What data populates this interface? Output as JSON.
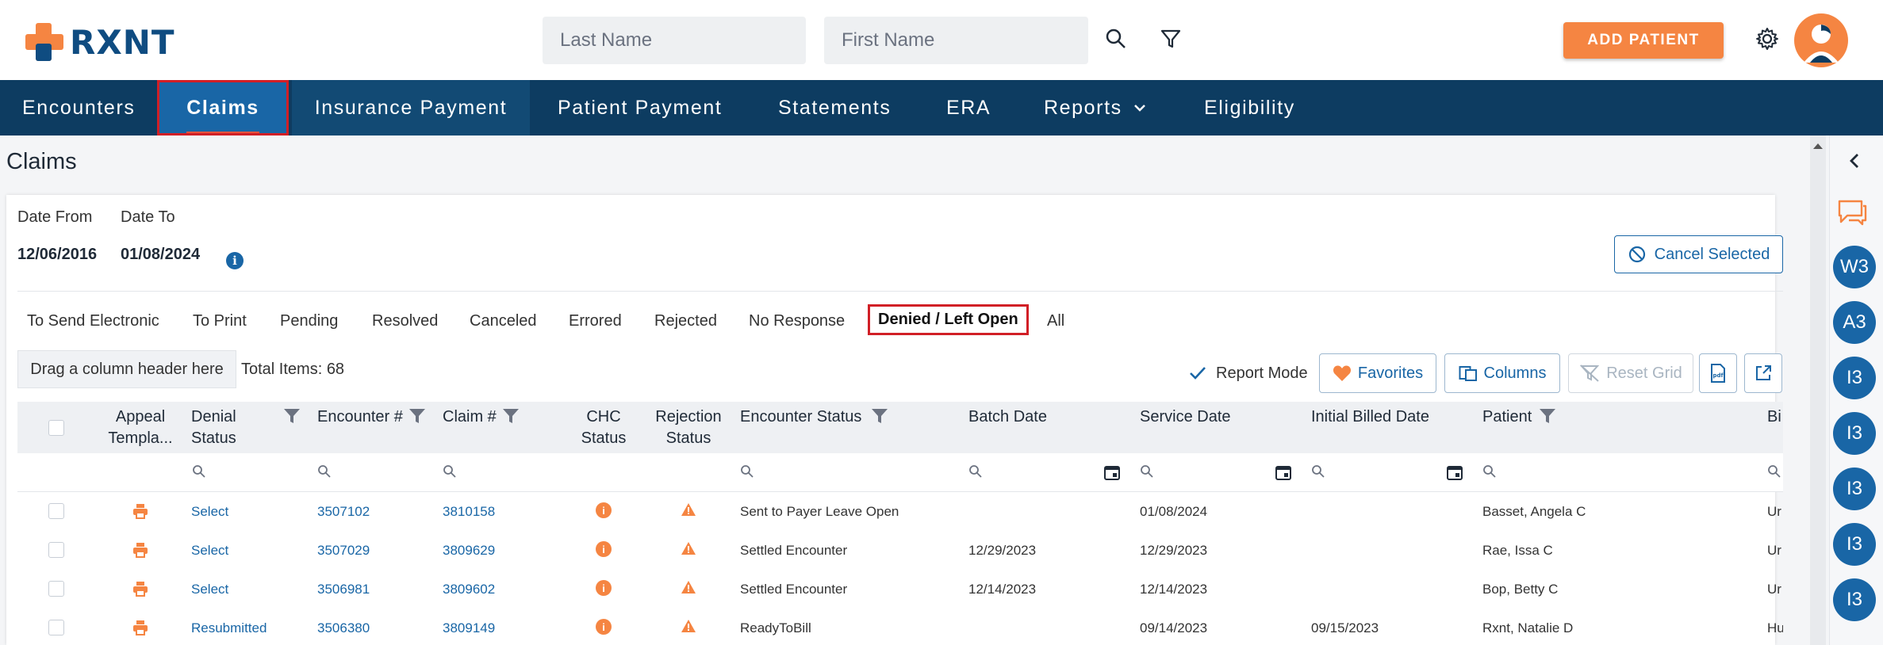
{
  "app": {
    "logo_text": "RXNT",
    "brand_color": "#0f4c81",
    "accent_color": "#f58542"
  },
  "header": {
    "last_name_placeholder": "Last Name",
    "first_name_placeholder": "First Name",
    "add_patient_label": "ADD PATIENT"
  },
  "nav": {
    "items": [
      {
        "label": "Encounters"
      },
      {
        "label": "Claims"
      },
      {
        "label": "Insurance Payment"
      },
      {
        "label": "Patient Payment"
      },
      {
        "label": "Statements"
      },
      {
        "label": "ERA"
      },
      {
        "label": "Reports"
      },
      {
        "label": "Eligibility"
      }
    ]
  },
  "page": {
    "title": "Claims",
    "date_from_label": "Date From",
    "date_to_label": "Date To",
    "date_from": "12/06/2016",
    "date_to": "01/08/2024",
    "cancel_selected_label": "Cancel Selected"
  },
  "tabs": [
    "To Send Electronic",
    "To Print",
    "Pending",
    "Resolved",
    "Canceled",
    "Errored",
    "Rejected",
    "No Response",
    "Denied / Left Open",
    "All"
  ],
  "toolbar": {
    "drag_hint": "Drag a column header here",
    "total_items": "Total Items: 68",
    "report_mode_label": "Report Mode",
    "favorites_label": "Favorites",
    "columns_label": "Columns",
    "reset_grid_label": "Reset Grid"
  },
  "grid": {
    "headers": {
      "appeal": "Appeal Templa...",
      "denial": "Denial Status",
      "encounter": "Encounter #",
      "claim": "Claim #",
      "chc": "CHC Status",
      "rejection": "Rejection Status",
      "enc_status": "Encounter Status",
      "batch": "Batch Date",
      "service": "Service Date",
      "initial": "Initial Billed Date",
      "patient": "Patient",
      "bi": "Bi"
    },
    "rows": [
      {
        "denial": "Select",
        "encounter": "3507102",
        "claim": "3810158",
        "enc_status": "Sent to Payer Leave Open",
        "batch": "",
        "service": "01/08/2024",
        "initial": "",
        "patient": "Basset, Angela C",
        "bi": "Ur"
      },
      {
        "denial": "Select",
        "encounter": "3507029",
        "claim": "3809629",
        "enc_status": "Settled Encounter",
        "batch": "12/29/2023",
        "service": "12/29/2023",
        "initial": "",
        "patient": "Rae, Issa C",
        "bi": "Ur"
      },
      {
        "denial": "Select",
        "encounter": "3506981",
        "claim": "3809602",
        "enc_status": "Settled Encounter",
        "batch": "12/14/2023",
        "service": "12/14/2023",
        "initial": "",
        "patient": "Bop, Betty C",
        "bi": "Ur"
      },
      {
        "denial": "Resubmitted",
        "encounter": "3506380",
        "claim": "3809149",
        "enc_status": "ReadyToBill",
        "batch": "",
        "service": "09/14/2023",
        "initial": "09/15/2023",
        "patient": "Rxnt, Natalie D",
        "bi": "Hu"
      }
    ]
  },
  "sidebar": {
    "bubbles": [
      "W3",
      "A3",
      "I3",
      "I3",
      "I3",
      "I3",
      "I3"
    ]
  }
}
